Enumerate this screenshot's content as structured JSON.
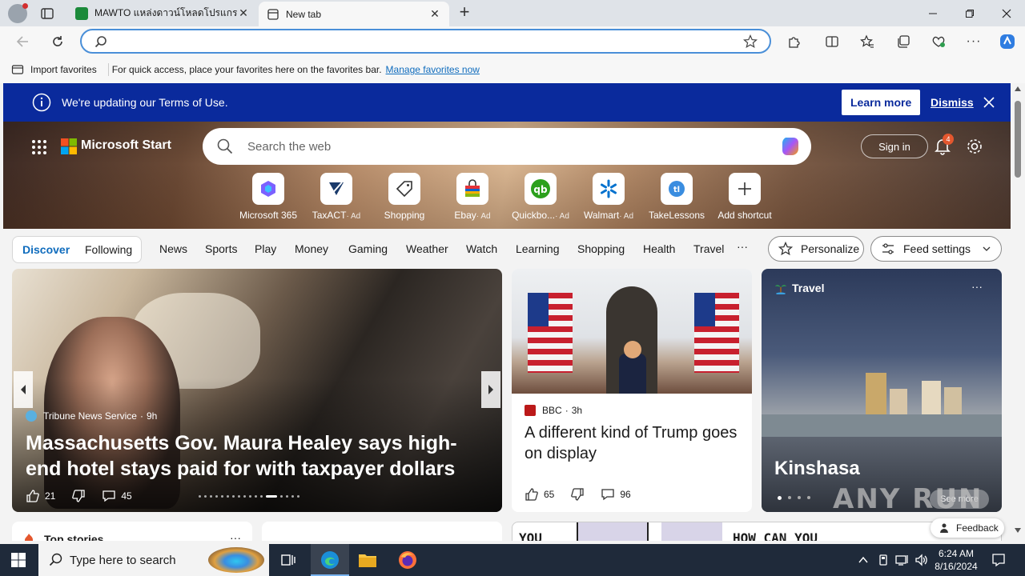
{
  "tabs": [
    {
      "label": "MAWTO แหล่งดาวน์โหลดโปรแกรมฟรี",
      "active": false
    },
    {
      "label": "New tab",
      "active": true
    }
  ],
  "favorites_bar": {
    "import_label": "Import favorites",
    "message": "For quick access, place your favorites here on the favorites bar.",
    "manage_link": "Manage favorites now"
  },
  "banner": {
    "text": "We're updating our Terms of Use.",
    "learn_more": "Learn more",
    "dismiss": "Dismiss"
  },
  "msn": {
    "brand": "Microsoft Start",
    "search_placeholder": "Search the web",
    "sign_in": "Sign in",
    "notification_count": "4"
  },
  "quick_links": [
    {
      "label": "Microsoft 365",
      "ad": ""
    },
    {
      "label": "TaxACT",
      "ad": "· Ad"
    },
    {
      "label": "Shopping",
      "ad": ""
    },
    {
      "label": "Ebay",
      "ad": "· Ad"
    },
    {
      "label": "Quickbo...",
      "ad": "· Ad"
    },
    {
      "label": "Walmart",
      "ad": "· Ad"
    },
    {
      "label": "TakeLessons",
      "ad": ""
    },
    {
      "label": "Add shortcut",
      "ad": ""
    }
  ],
  "nav": {
    "discover": "Discover",
    "following": "Following",
    "items": [
      "News",
      "Sports",
      "Play",
      "Money",
      "Gaming",
      "Weather",
      "Watch",
      "Learning",
      "Shopping",
      "Health",
      "Travel"
    ],
    "more": "···",
    "personalize": "Personalize",
    "feed_settings": "Feed settings"
  },
  "main_story": {
    "source": "Tribune News Service",
    "age": "9h",
    "headline": "Massachusetts Gov. Maura Healey says high-end hotel stays paid for with taxpayer dollars were an…",
    "likes": "21",
    "comments": "45"
  },
  "bbc_story": {
    "source": "BBC",
    "age": "3h",
    "headline": "A different kind of Trump goes on display",
    "likes": "65",
    "comments": "96"
  },
  "travel": {
    "category": "Travel",
    "place": "Kinshasa",
    "see_more": "See more"
  },
  "lower": {
    "top_stories": "Top stories",
    "feedback": "Feedback",
    "comic_text_1": "YOU",
    "comic_text_2": "HOW CAN YOU"
  },
  "taskbar": {
    "search_placeholder": "Type here to search",
    "time": "6:24 AM",
    "date": "8/16/2024"
  },
  "watermark": "ANY RUN",
  "colors": {
    "banner": "#0a2a9c",
    "address_border": "#4a8fd8",
    "discover_blue": "#0f6cbd"
  }
}
